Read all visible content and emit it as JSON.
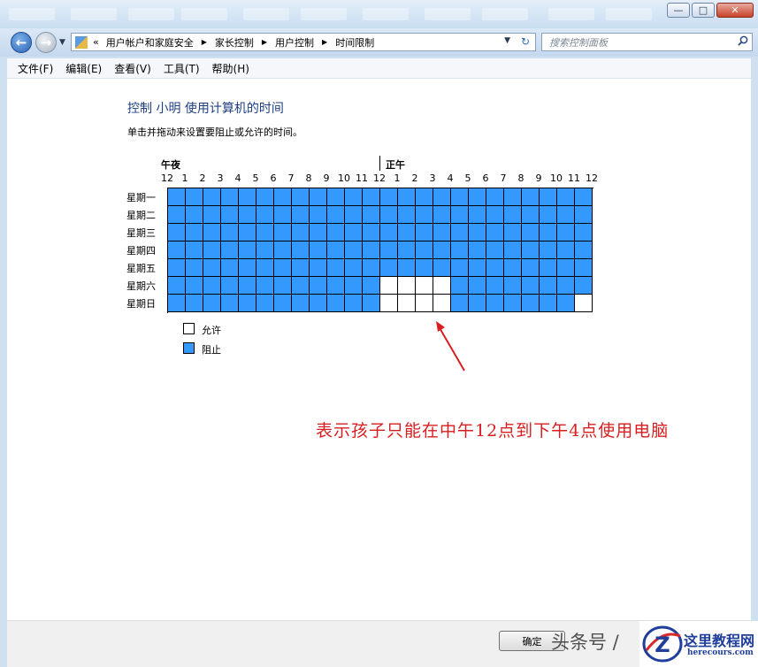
{
  "window": {
    "title_tabs": [
      "",
      "",
      "",
      "",
      "",
      "",
      "",
      "",
      "",
      "",
      ""
    ],
    "buttons": {
      "minimize": "—",
      "maximize": "□",
      "close": "✕"
    }
  },
  "nav": {
    "breadcrumb_overflow": "«",
    "breadcrumb": [
      "用户帐户和家庭安全",
      "家长控制",
      "用户控制",
      "时间限制"
    ],
    "search_placeholder": "搜索控制面板"
  },
  "menu": [
    "文件(F)",
    "编辑(E)",
    "查看(V)",
    "工具(T)",
    "帮助(H)"
  ],
  "page": {
    "title": "控制 小明 使用计算机的时间",
    "subtitle": "单击并拖动来设置要阻止或允许的时间。",
    "label_midnight": "午夜",
    "label_noon": "正午"
  },
  "schedule": {
    "hours": [
      "12",
      "1",
      "2",
      "3",
      "4",
      "5",
      "6",
      "7",
      "8",
      "9",
      "10",
      "11",
      "12",
      "1",
      "2",
      "3",
      "4",
      "5",
      "6",
      "7",
      "8",
      "9",
      "10",
      "11",
      "12"
    ],
    "days": [
      "星期一",
      "星期二",
      "星期三",
      "星期四",
      "星期五",
      "星期六",
      "星期日"
    ],
    "allowed_slots": [
      [],
      [],
      [],
      [],
      [],
      [
        12,
        13,
        14,
        15
      ],
      [
        12,
        13,
        14,
        15,
        23
      ]
    ]
  },
  "legend": {
    "allow": "允许",
    "block": "阻止"
  },
  "annotation": "表示孩子只能在中午12点到下午4点使用电脑",
  "footer": {
    "ok_label": "确定",
    "watermark": "头条号 /",
    "logo_title": "这里教程网",
    "logo_url": "herecours.com",
    "logo_letter": "Z"
  },
  "colors": {
    "blocked": "#3399ff",
    "allowed": "#ffffff",
    "annotation": "#d81e1e",
    "title": "#1e3f84"
  }
}
